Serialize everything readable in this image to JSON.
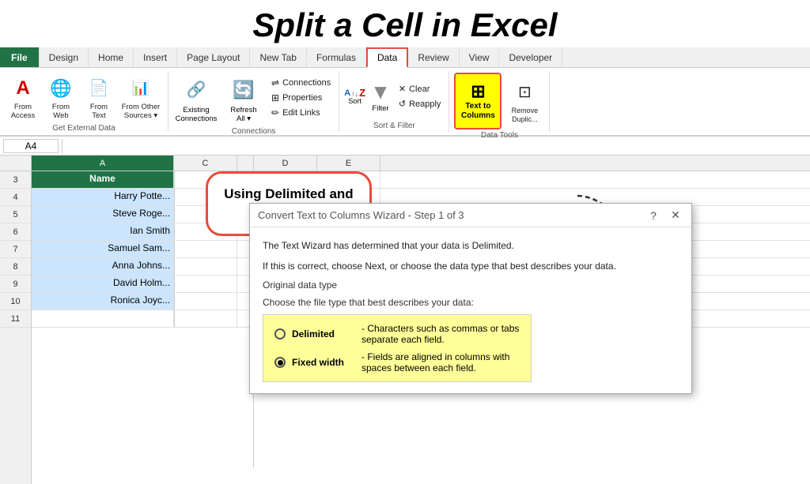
{
  "page": {
    "title": "Split a Cell in Excel"
  },
  "ribbon": {
    "tabs": [
      {
        "label": "File",
        "type": "file"
      },
      {
        "label": "Design"
      },
      {
        "label": "Home"
      },
      {
        "label": "Insert"
      },
      {
        "label": "Page Layout"
      },
      {
        "label": "New Tab"
      },
      {
        "label": "Formulas"
      },
      {
        "label": "Data",
        "active": true
      },
      {
        "label": "Review"
      },
      {
        "label": "View"
      },
      {
        "label": "Developer"
      }
    ],
    "groups": {
      "get_external_data": {
        "label": "Get External Data",
        "buttons": [
          {
            "id": "from-access",
            "label": "From\nAccess",
            "icon": "🗄"
          },
          {
            "id": "from-web",
            "label": "From\nWeb",
            "icon": "🌐"
          },
          {
            "id": "from-text",
            "label": "From\nText",
            "icon": "📄"
          },
          {
            "id": "from-other",
            "label": "From Other\nSources ▾",
            "icon": "📊"
          }
        ]
      },
      "connections": {
        "label": "Connections",
        "existing": {
          "label": "Existing\nConnections"
        },
        "refresh": {
          "label": "Refresh\nAll ▾"
        },
        "small_buttons": [
          {
            "label": "Connections"
          },
          {
            "label": "Properties"
          },
          {
            "label": "Edit Links"
          }
        ]
      },
      "sort_filter": {
        "label": "Sort & Filter",
        "sort_label": "Sort",
        "filter_label": "Filter",
        "clear_label": "Clear",
        "reapply_label": "Reapply"
      },
      "data_tools": {
        "text_to_columns": "Text to\nColumns",
        "remove_duplicates": "Remove\nDuplic..."
      }
    }
  },
  "formula_bar": {
    "name_box": "A4"
  },
  "spreadsheet": {
    "columns": [
      "A",
      "C",
      "D",
      "E"
    ],
    "rows": [
      {
        "num": 3,
        "col_a": "Name",
        "type": "header"
      },
      {
        "num": 4,
        "col_a": "Harry Potte...",
        "type": "data"
      },
      {
        "num": 5,
        "col_a": "Steve Roge...",
        "type": "data"
      },
      {
        "num": 6,
        "col_a": "Ian Smith",
        "type": "data"
      },
      {
        "num": 7,
        "col_a": "Samuel Sam...",
        "type": "data"
      },
      {
        "num": 8,
        "col_a": "Anna Johns...",
        "type": "data"
      },
      {
        "num": 9,
        "col_a": "David Holm...",
        "type": "data"
      },
      {
        "num": 10,
        "col_a": "Ronica Joyc...",
        "type": "data"
      },
      {
        "num": 11,
        "col_a": "",
        "type": "empty"
      }
    ]
  },
  "callout": {
    "text": "Using Delimited and\nFixed width"
  },
  "dialog": {
    "title": "Convert Text to Columns Wizard - Step 1 of 3",
    "help": "?",
    "close": "✕",
    "desc1": "The Text Wizard has determined that your data is Delimited.",
    "desc2": "If this is correct, choose Next, or choose the data type that best describes your data.",
    "original_label": "Original data type",
    "choose_label": "Choose the file type that best describes your data:",
    "options": [
      {
        "label": "Delimited",
        "desc": "- Characters such as commas or tabs separate each field.",
        "selected": false
      },
      {
        "label": "Fixed width",
        "desc": "- Fields are aligned in columns with spaces between each field.",
        "selected": true
      }
    ]
  }
}
